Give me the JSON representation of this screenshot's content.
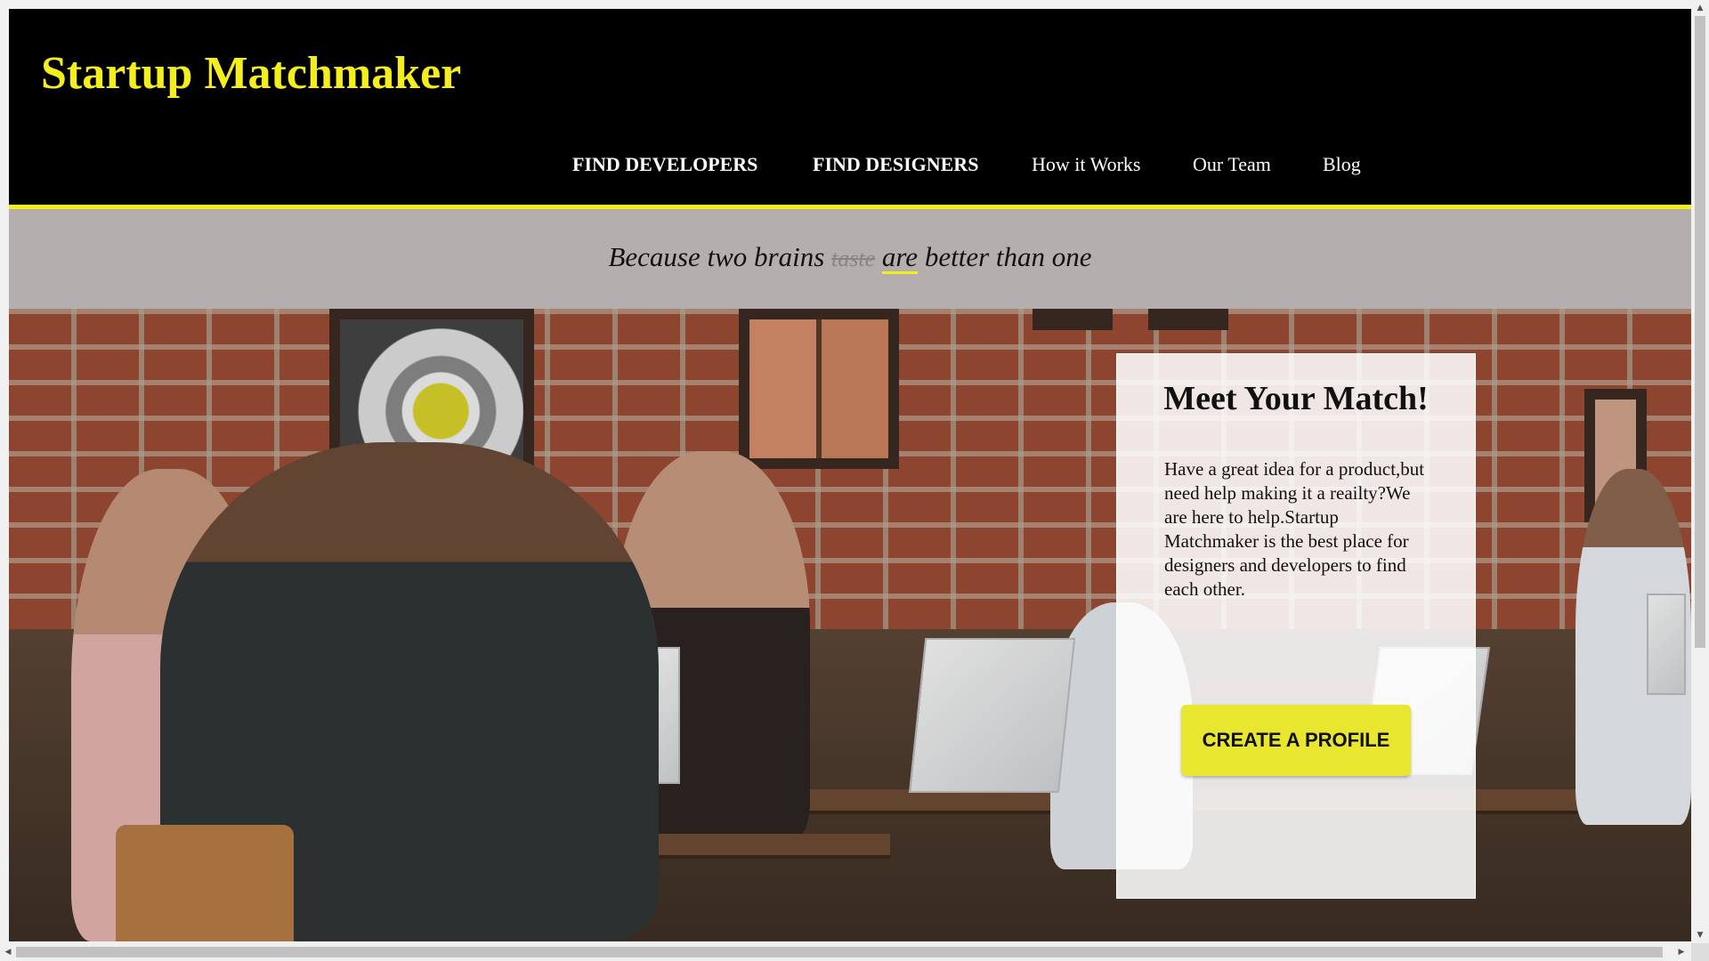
{
  "header": {
    "logo": "Startup Matchmaker",
    "nav": [
      {
        "label": "FIND DEVELOPERS"
      },
      {
        "label": "FIND DESIGNERS"
      },
      {
        "label": "How it Works"
      },
      {
        "label": "Our Team"
      },
      {
        "label": "Blog"
      }
    ]
  },
  "tagline": {
    "before": "Because two brains",
    "struck": "taste",
    "underlined": "are",
    "after": "better than one"
  },
  "card": {
    "title": "Meet Your Match!",
    "body": "Have a great idea for a product,but need help making it a reailty?We are here to help.Startup Matchmaker is the best place for designers and developers to find each other.",
    "cta": "CREATE A PROFILE"
  },
  "colors": {
    "accent": "#f4ee1c",
    "header_bg": "#000000",
    "tagline_bg": "#b4aeae",
    "button_bg": "#e8e62f"
  },
  "icons": {
    "scroll_up": "▲",
    "scroll_down": "▼",
    "scroll_left": "◀",
    "scroll_right": "▶"
  }
}
